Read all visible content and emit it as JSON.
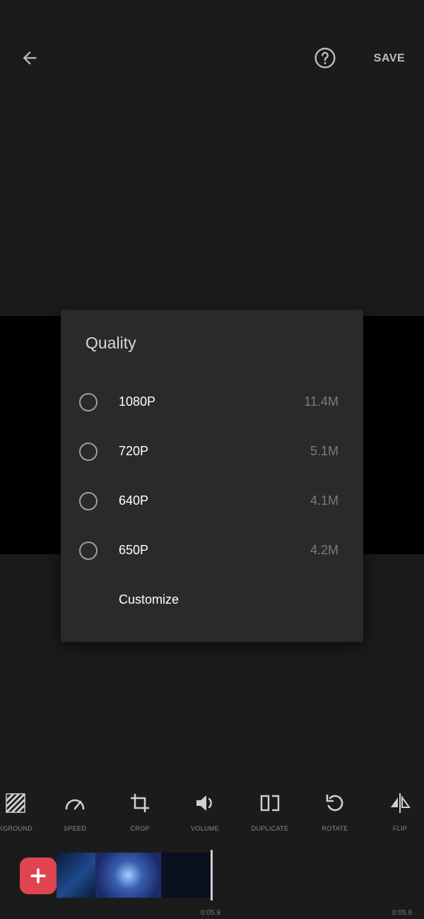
{
  "topbar": {
    "back_icon": "arrow-left-icon",
    "help_icon": "question-circle-icon",
    "save_label": "SAVE"
  },
  "dialog": {
    "title": "Quality",
    "options": [
      {
        "label": "1080P",
        "size": "11.4M"
      },
      {
        "label": "720P",
        "size": "5.1M"
      },
      {
        "label": "640P",
        "size": "4.1M"
      },
      {
        "label": "650P",
        "size": "4.2M"
      }
    ],
    "customize_label": "Customize"
  },
  "toolbar": {
    "items": [
      {
        "label": "KGROUND",
        "icon": "background-stripes-icon"
      },
      {
        "label": "SPEED",
        "icon": "speedometer-icon"
      },
      {
        "label": "CROP",
        "icon": "crop-icon"
      },
      {
        "label": "VOLUME",
        "icon": "volume-icon"
      },
      {
        "label": "DUPLICATE",
        "icon": "duplicate-icon"
      },
      {
        "label": "ROTATE",
        "icon": "rotate-icon"
      },
      {
        "label": "FLIP",
        "icon": "flip-icon"
      }
    ]
  },
  "timeline": {
    "add_icon": "plus-icon",
    "time_current": "0:05.9",
    "time_total": "0:05.9"
  },
  "colors": {
    "background": "#1b1b1b",
    "dialog": "#2a2a2a",
    "accent_add": "#e04451"
  }
}
